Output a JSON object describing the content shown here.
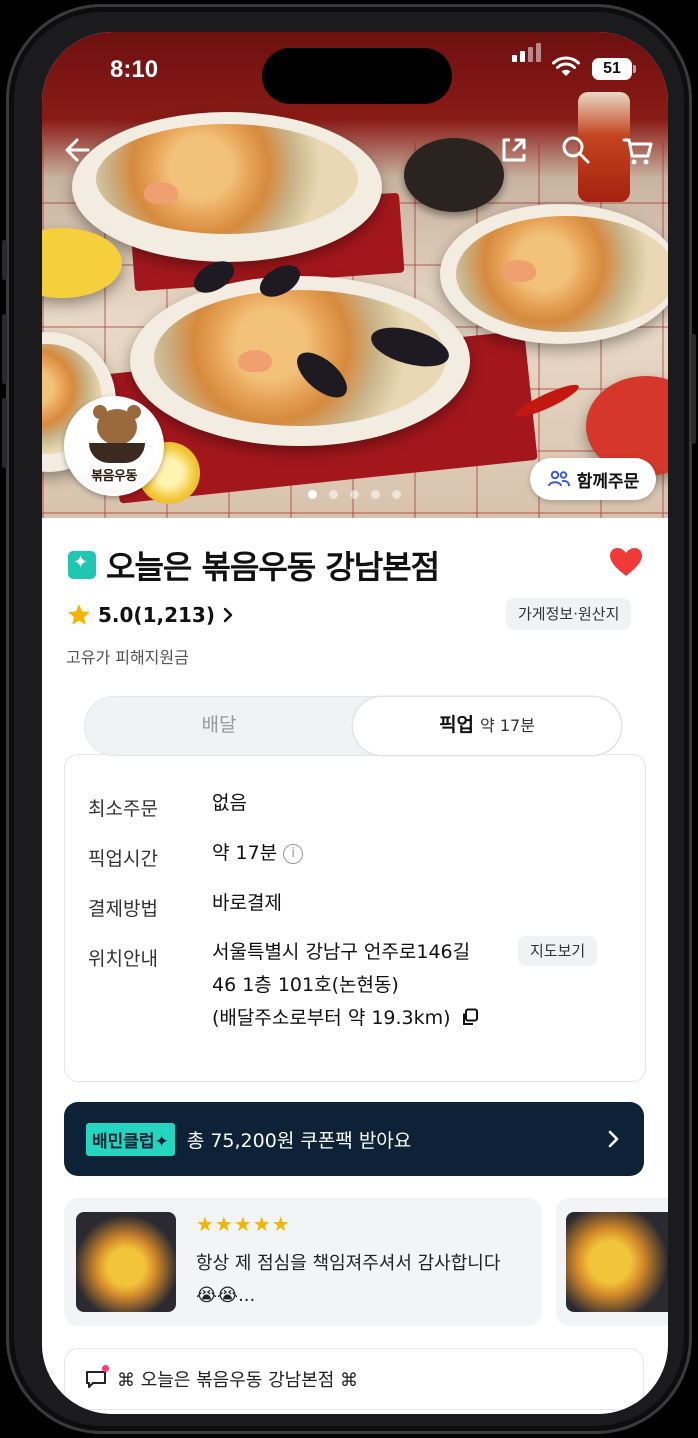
{
  "status_bar": {
    "time": "8:10",
    "battery": "51"
  },
  "hero": {
    "logo_text": "볶음우동",
    "together_order": "함께주문",
    "carousel_count": 5,
    "carousel_active": 1
  },
  "store": {
    "name": "오늘은 볶음우동 강남본점",
    "rating": "5.0(1,213)",
    "info_chip": "가게정보·원산지",
    "subtitle": "고유가 피해지원금"
  },
  "tabs": {
    "delivery": "배달",
    "pickup": "픽업",
    "pickup_eta": "약 17분"
  },
  "pickup_info": {
    "rows": [
      {
        "key": "최소주문",
        "value": "없음"
      },
      {
        "key": "픽업시간",
        "value": "약 17분"
      },
      {
        "key": "결제방법",
        "value": "바로결제"
      },
      {
        "key": "위치안내",
        "value_line1": "서울특별시 강남구 언주로146길",
        "value_line2": "46 1층 101호(논현동)",
        "value_line3": "(배달주소로부터 약 19.3km)"
      }
    ],
    "map_button": "지도보기"
  },
  "club_banner": {
    "logo": "배민클럽✦",
    "text": "총 75,200원 쿠폰팩 받아요"
  },
  "review": {
    "stars": "★★★★★",
    "text": "항상 제 점심을 책임져주셔서 감사합니다 😭😭..."
  },
  "notice": {
    "text": "⌘ 오늘은 볶음우동 강남본점 ⌘"
  },
  "colors": {
    "accent_mint": "#26d5c0",
    "banner_navy": "#0d2236",
    "heart_red": "#f03a3a",
    "star_yellow": "#f5b400"
  }
}
